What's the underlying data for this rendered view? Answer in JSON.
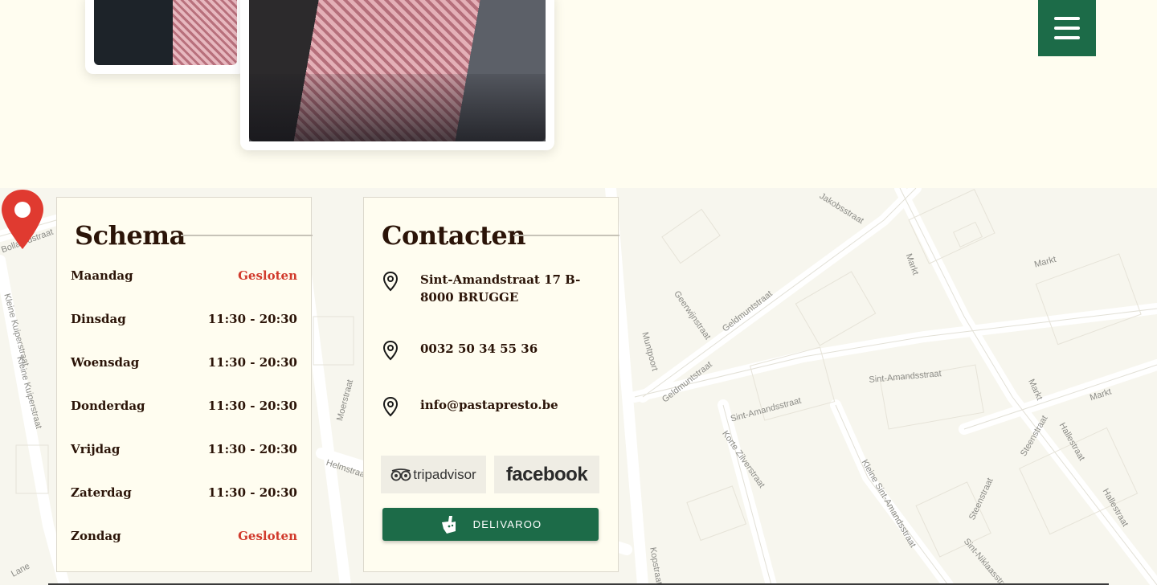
{
  "menu": {
    "aria": "menu"
  },
  "schedule": {
    "title": "Schema",
    "rows": [
      {
        "day": "Maandag",
        "hours": "Gesloten",
        "closed": true
      },
      {
        "day": "Dinsdag",
        "hours": "11:30 - 20:30",
        "closed": false
      },
      {
        "day": "Woensdag",
        "hours": "11:30 - 20:30",
        "closed": false
      },
      {
        "day": "Donderdag",
        "hours": "11:30 - 20:30",
        "closed": false
      },
      {
        "day": "Vrijdag",
        "hours": "11:30 - 20:30",
        "closed": false
      },
      {
        "day": "Zaterdag",
        "hours": "11:30 - 20:30",
        "closed": false
      },
      {
        "day": "Zondag",
        "hours": "Gesloten",
        "closed": true
      }
    ]
  },
  "contact": {
    "title": "Contacten",
    "address_line1": "Sint-Amandstraat 17 B-",
    "address_line2": "8000 BRUGGE",
    "phone": "0032 50 34 55 36",
    "email": "info@pastapresto.be",
    "tripadvisor_label": "tripadvisor",
    "facebook_label": "facebook",
    "deliveroo_label": "DELIVAROO"
  },
  "map": {
    "streets": [
      "Bollaardstraat",
      "Kleine Kuiperstraat",
      "Kleine Kuiperstraat",
      "Moerstraat",
      "Helmstraa",
      "Geerwijnstraat",
      "Geldmuntstraat",
      "Geldmuntstraat",
      "Muntpoort",
      "Sint-Amandsstraat",
      "Sint-Amandsstraat",
      "Korte Zilverstraat",
      "Kleine Sint-Amandsstraat",
      "Markt",
      "Markt",
      "Markt",
      "Markt",
      "Steenstraat",
      "Steenstraat",
      "Hallestraat",
      "Hallestraat",
      "Sint-Niklaasstraat",
      "Jakobsstraat",
      "Kopstraat",
      "Lane"
    ],
    "pin_color": "#e03a30"
  },
  "colors": {
    "brand_green": "#1c6b48",
    "closed_red": "#d13a2c",
    "text_brown": "#2b1408",
    "background": "#fffdf0"
  }
}
